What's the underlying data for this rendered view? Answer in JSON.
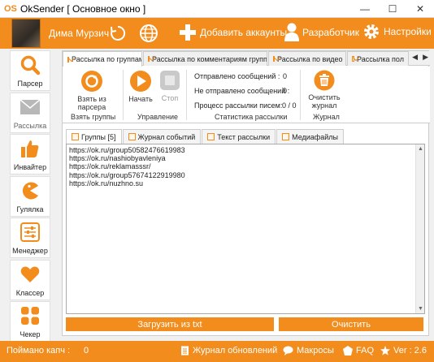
{
  "window": {
    "app_icon_text": "OS",
    "title": "OkSender [ Основное окно ]",
    "minimize": "—",
    "maximize": "☐",
    "close": "✕"
  },
  "header": {
    "username": "Дима Мурзич",
    "add_account": "Добавить аккаунты",
    "developer": "Разработчик",
    "settings": "Настройки"
  },
  "sidebar": {
    "items": [
      {
        "label": "Парсер",
        "icon": "search-icon"
      },
      {
        "label": "Рассылка",
        "icon": "envelope-icon"
      },
      {
        "label": "Инвайтер",
        "icon": "thumbs-up-icon"
      },
      {
        "label": "Гулялка",
        "icon": "pacman-icon"
      },
      {
        "label": "Менеджер",
        "icon": "sliders-icon"
      },
      {
        "label": "Классер",
        "icon": "heart-icon"
      },
      {
        "label": "Чекер",
        "icon": "grid-icon"
      }
    ]
  },
  "tabs": [
    {
      "label": "Рассылка по группам",
      "active": true
    },
    {
      "label": "Рассылка по комментариям групп",
      "active": false
    },
    {
      "label": "Рассылка по видео",
      "active": false
    },
    {
      "label": "Рассылка пол",
      "active": false
    }
  ],
  "ribbon": {
    "take_from_parser": "Взять из парсера",
    "take_groups_label": "Взять группы",
    "start": "Начать",
    "stop": "Стоп",
    "control_label": "Управление",
    "sent_label": "Отправлено сообщений :",
    "sent_value": "0",
    "not_sent_label": "Не отправлено сообщений :",
    "not_sent_value": "0",
    "process_label": "Процесс рассылки писем:",
    "process_value": "0 / 0",
    "stats_label": "Статистика рассылки",
    "clear_journal": "Очистить журнал",
    "journal_label": "Журнал"
  },
  "subtabs": [
    {
      "label": "Группы [5]",
      "active": true
    },
    {
      "label": "Журнал событий",
      "active": false
    },
    {
      "label": "Текст рассылки",
      "active": false
    },
    {
      "label": "Медиафайлы",
      "active": false
    }
  ],
  "groups_list": [
    "https://ok.ru/group50582476619983",
    "https://ok.ru/nashiobyavleniya",
    "https://ok.ru/reklamasssr/",
    "https://ok.ru/group57674122919980",
    "https://ok.ru/nuzhno.su"
  ],
  "buttons": {
    "load_txt": "Загрузить из txt",
    "clear": "Очистить"
  },
  "statusbar": {
    "captcha_label": "Поймано капч :",
    "captcha_value": "0",
    "updates": "Журнал обновлений",
    "macros": "Макросы",
    "faq": "FAQ",
    "version": "Ver : 2.6"
  },
  "colors": {
    "accent": "#f28c1c"
  }
}
